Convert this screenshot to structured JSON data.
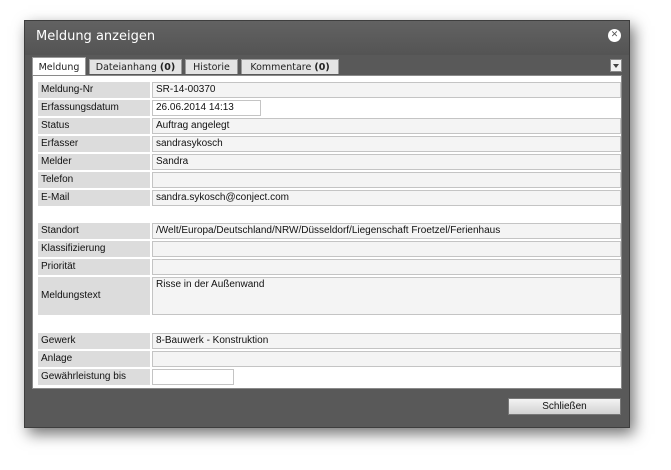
{
  "dialog": {
    "title": "Meldung anzeigen"
  },
  "tabs": [
    {
      "label": "Meldung",
      "count": ""
    },
    {
      "label": "Dateianhang",
      "count": "(0)"
    },
    {
      "label": "Historie",
      "count": ""
    },
    {
      "label": "Kommentare",
      "count": "(0)"
    }
  ],
  "fields": {
    "meldung_nr": {
      "label": "Meldung-Nr",
      "value": "SR-14-00370"
    },
    "erfassungsdatum": {
      "label": "Erfassungsdatum",
      "value": "26.06.2014 14:13"
    },
    "status": {
      "label": "Status",
      "value": "Auftrag angelegt"
    },
    "erfasser": {
      "label": "Erfasser",
      "value": "sandrasykosch"
    },
    "melder": {
      "label": "Melder",
      "value": "Sandra"
    },
    "telefon": {
      "label": "Telefon",
      "value": ""
    },
    "email": {
      "label": "E-Mail",
      "value": "sandra.sykosch@conject.com"
    },
    "standort": {
      "label": "Standort",
      "value": "/Welt/Europa/Deutschland/NRW/Düsseldorf/Liegenschaft Froetzel/Ferienhaus"
    },
    "klassifizierung": {
      "label": "Klassifizierung",
      "value": ""
    },
    "prioritaet": {
      "label": "Priorität",
      "value": ""
    },
    "meldungstext": {
      "label": "Meldungstext",
      "value": "Risse in der Außenwand"
    },
    "gewerk": {
      "label": "Gewerk",
      "value": "8-Bauwerk - Konstruktion"
    },
    "anlage": {
      "label": "Anlage",
      "value": ""
    },
    "gewaehrleistung": {
      "label": "Gewährleistung bis",
      "value": ""
    }
  },
  "footer": {
    "close_label": "Schließen"
  },
  "icons": {
    "close": "close-icon",
    "tab_menu": "chevron-down-icon"
  }
}
